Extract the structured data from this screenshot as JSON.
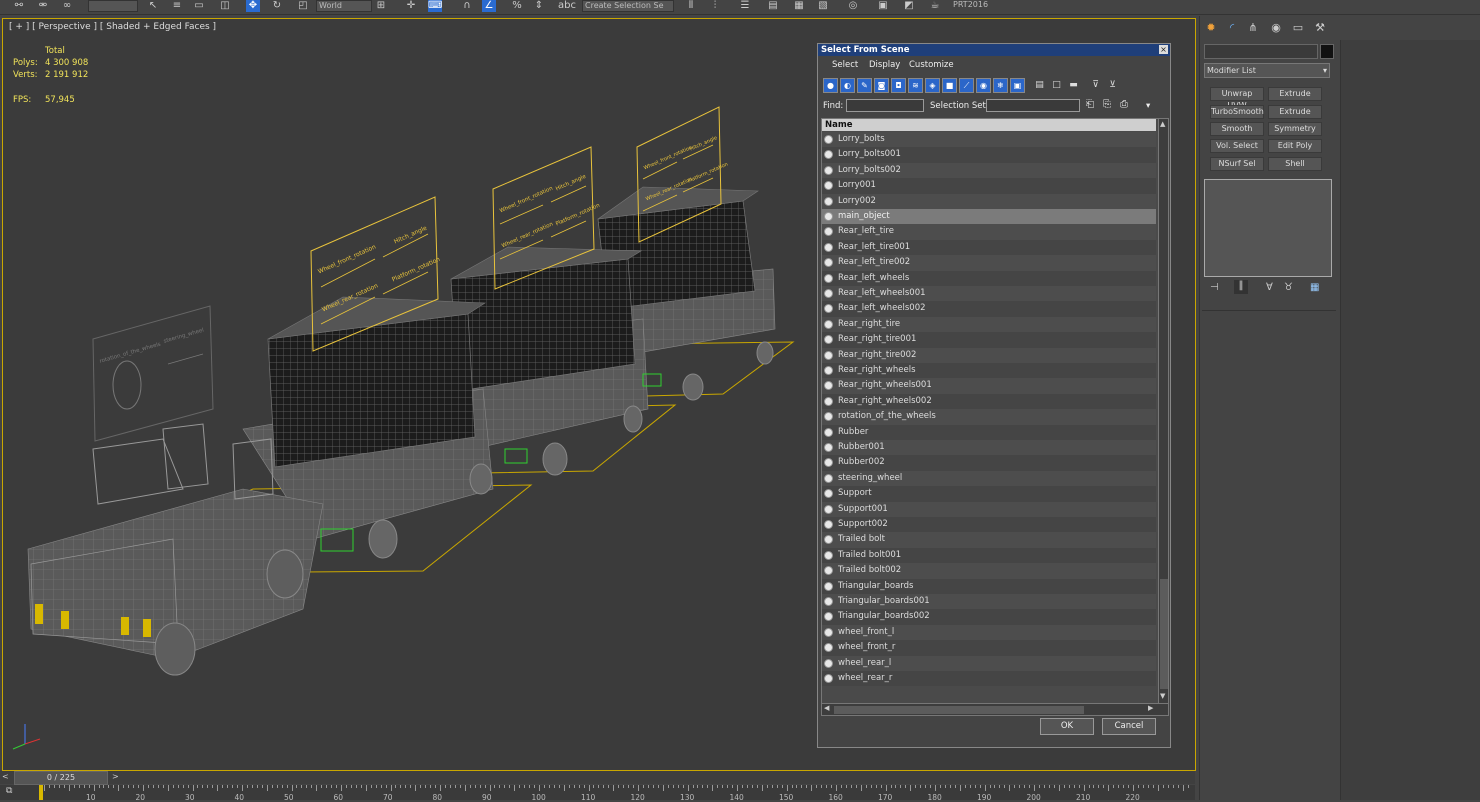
{
  "toolbar": {
    "coord_system": "World",
    "named_selection": "Create Selection Se",
    "project": "PRT2016"
  },
  "viewport": {
    "label": "[ + ] [ Perspective ] [ Shaded + Edged Faces ]",
    "stats": {
      "total_label": "Total",
      "polys_label": "Polys:",
      "polys_value": "4 300 908",
      "verts_label": "Verts:",
      "verts_value": "2 191 912",
      "fps_label": "FPS:",
      "fps_value": "57,945"
    },
    "gizmo_panels": [
      {
        "a": "Wheel_front_rotation",
        "b": "Hitch_angle",
        "c": "Wheel_rear_rotation",
        "d": "Platform_rotation"
      },
      {
        "a": "Wheel_front_rotation",
        "b": "Hitch_angle",
        "c": "Wheel_rear_rotation",
        "d": "Platform_rotation"
      },
      {
        "a": "Wheel_front_rotation",
        "b": "Hitch_angle",
        "c": "Wheel_rear_rotation",
        "d": "Platform_rotation"
      }
    ],
    "steering_panel": {
      "a": "rotation_of_the_wheels",
      "b": "steering_wheel"
    }
  },
  "dialog": {
    "title": "Select From Scene",
    "close_glyph": "×",
    "menu": [
      "Select",
      "Display",
      "Customize"
    ],
    "find_label": "Find:",
    "find_value": "",
    "selection_set_label": "Selection Set:",
    "selection_set_value": "",
    "column_name": "Name",
    "ok_label": "OK",
    "cancel_label": "Cancel",
    "items": [
      {
        "name": "Lorry_bolts",
        "selected": false
      },
      {
        "name": "Lorry_bolts001",
        "selected": false
      },
      {
        "name": "Lorry_bolts002",
        "selected": false
      },
      {
        "name": "Lorry001",
        "selected": false
      },
      {
        "name": "Lorry002",
        "selected": false
      },
      {
        "name": "main_object",
        "selected": true
      },
      {
        "name": "Rear_left_tire",
        "selected": false
      },
      {
        "name": "Rear_left_tire001",
        "selected": false
      },
      {
        "name": "Rear_left_tire002",
        "selected": false
      },
      {
        "name": "Rear_left_wheels",
        "selected": false
      },
      {
        "name": "Rear_left_wheels001",
        "selected": false
      },
      {
        "name": "Rear_left_wheels002",
        "selected": false
      },
      {
        "name": "Rear_right_tire",
        "selected": false
      },
      {
        "name": "Rear_right_tire001",
        "selected": false
      },
      {
        "name": "Rear_right_tire002",
        "selected": false
      },
      {
        "name": "Rear_right_wheels",
        "selected": false
      },
      {
        "name": "Rear_right_wheels001",
        "selected": false
      },
      {
        "name": "Rear_right_wheels002",
        "selected": false
      },
      {
        "name": "rotation_of_the_wheels",
        "selected": false
      },
      {
        "name": "Rubber",
        "selected": false
      },
      {
        "name": "Rubber001",
        "selected": false
      },
      {
        "name": "Rubber002",
        "selected": false
      },
      {
        "name": "steering_wheel",
        "selected": false
      },
      {
        "name": "Support",
        "selected": false
      },
      {
        "name": "Support001",
        "selected": false
      },
      {
        "name": "Support002",
        "selected": false
      },
      {
        "name": "Trailed bolt",
        "selected": false
      },
      {
        "name": "Trailed bolt001",
        "selected": false
      },
      {
        "name": "Trailed bolt002",
        "selected": false
      },
      {
        "name": "Triangular_boards",
        "selected": false
      },
      {
        "name": "Triangular_boards001",
        "selected": false
      },
      {
        "name": "Triangular_boards002",
        "selected": false
      },
      {
        "name": "wheel_front_l",
        "selected": false
      },
      {
        "name": "wheel_front_r",
        "selected": false
      },
      {
        "name": "wheel_rear_l",
        "selected": false
      },
      {
        "name": "wheel_rear_r",
        "selected": false
      }
    ]
  },
  "command_panel": {
    "modifier_list_label": "Modifier List",
    "modifier_buttons": [
      "Unwrap UVW",
      "Extrude",
      "TurboSmooth",
      "Extrude",
      "Smooth",
      "Symmetry",
      "Vol. Select",
      "Edit Poly",
      "NSurf Sel",
      "Shell"
    ]
  },
  "timeline": {
    "frame_counter": "0 / 225",
    "ticks": [
      "10",
      "20",
      "30",
      "40",
      "50",
      "60",
      "70",
      "80",
      "90",
      "100",
      "110",
      "120",
      "130",
      "140",
      "150",
      "160",
      "170",
      "180",
      "190",
      "200",
      "210",
      "220"
    ]
  },
  "colors": {
    "viewport_border": "#c9a700",
    "stats_text": "#f2e45a",
    "dialog_title_bg": "#1f3f7a",
    "active_button": "#2b66c9",
    "gizmo_lines": "#e8c33c"
  }
}
